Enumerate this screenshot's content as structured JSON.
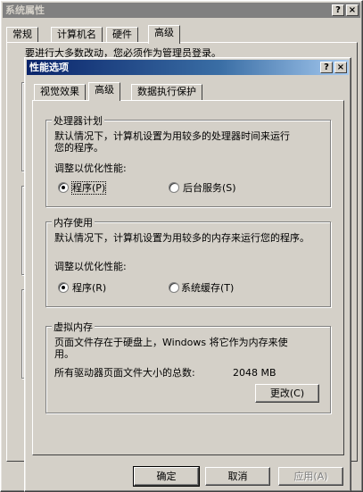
{
  "outer": {
    "title": "系统属性",
    "help_btn": "?",
    "close_btn": "×",
    "tabs": [
      "常规",
      "计算机名",
      "硬件",
      "高级"
    ],
    "notice": "要进行大多数改动，您必须作为管理员登录。"
  },
  "dialog": {
    "title": "性能选项",
    "help_btn": "?",
    "close_btn": "×",
    "tabs": [
      "视觉效果",
      "高级",
      "数据执行保护"
    ],
    "processor": {
      "label": "处理器计划",
      "desc1": "默认情况下，计算机设置为用较多的处理器时间来运行",
      "desc2": "您的程序。",
      "adjust": "调整以优化性能:",
      "opt1": "程序(P)",
      "opt2": "后台服务(S)"
    },
    "memory": {
      "label": "内存使用",
      "desc": "默认情况下，计算机设置为用较多的内存来运行您的程序。",
      "adjust": "调整以优化性能:",
      "opt1": "程序(R)",
      "opt2": "系统缓存(T)"
    },
    "virtual": {
      "label": "虚拟内存",
      "desc1": "页面文件存在于硬盘上，Windows 将它作为内存来使",
      "desc2": "用。",
      "total_label": "所有驱动器页面文件大小的总数:",
      "total_value": "2048 MB",
      "change_btn": "更改(C)"
    },
    "ok": "确定",
    "cancel": "取消",
    "apply": "应用(A)"
  }
}
